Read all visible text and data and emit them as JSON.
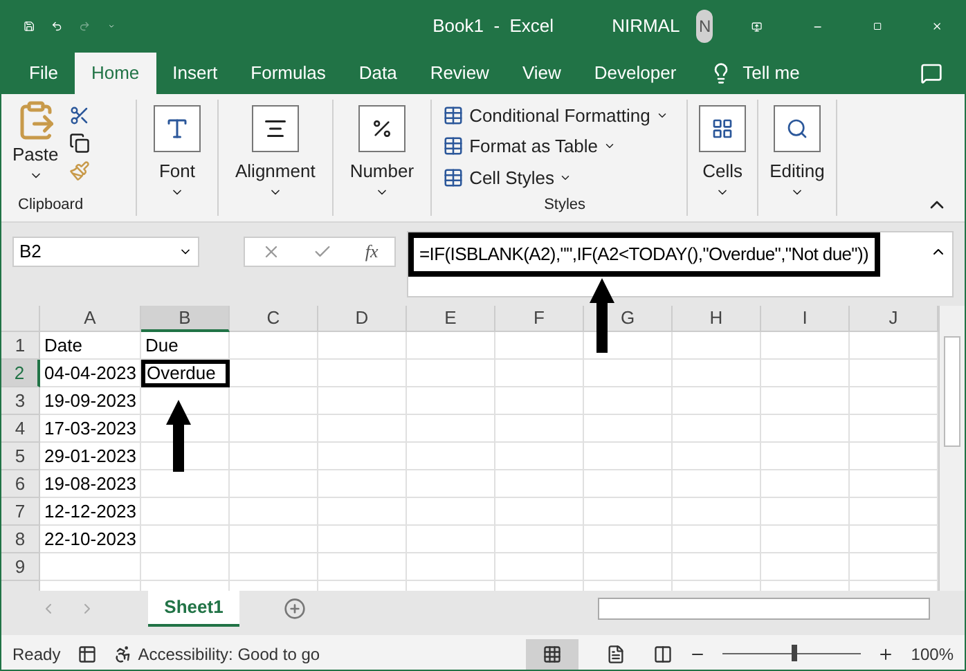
{
  "title_bar": {
    "title": "Book1  -  Excel",
    "user": "NIRMAL",
    "avatar": "N"
  },
  "ribbon_tabs": [
    {
      "label": "File",
      "selected": false
    },
    {
      "label": "Home",
      "selected": true
    },
    {
      "label": "Insert",
      "selected": false
    },
    {
      "label": "Formulas",
      "selected": false
    },
    {
      "label": "Data",
      "selected": false
    },
    {
      "label": "Review",
      "selected": false
    },
    {
      "label": "View",
      "selected": false
    },
    {
      "label": "Developer",
      "selected": false
    }
  ],
  "tell_me": "Tell me",
  "ribbon": {
    "clipboard": {
      "paste": "Paste",
      "group": "Clipboard"
    },
    "font": "Font",
    "alignment": "Alignment",
    "number": "Number",
    "styles": {
      "items": [
        "Conditional Formatting",
        "Format as Table",
        "Cell Styles"
      ],
      "group": "Styles"
    },
    "cells": "Cells",
    "editing": "Editing"
  },
  "name_box": "B2",
  "function_label": "fx",
  "formula": "=IF(ISBLANK(A2),\"\",IF(A2<TODAY(),\"Overdue\",\"Not due\"))",
  "columns": [
    {
      "label": "A",
      "selected": false
    },
    {
      "label": "B",
      "selected": true
    },
    {
      "label": "C",
      "selected": false
    },
    {
      "label": "D",
      "selected": false
    },
    {
      "label": "E",
      "selected": false
    },
    {
      "label": "F",
      "selected": false
    },
    {
      "label": "G",
      "selected": false
    },
    {
      "label": "H",
      "selected": false
    },
    {
      "label": "I",
      "selected": false
    },
    {
      "label": "J",
      "selected": false
    }
  ],
  "rows": [
    {
      "number": "1",
      "selected": false,
      "cells": [
        "Date",
        "Due"
      ]
    },
    {
      "number": "2",
      "selected": true,
      "cells": [
        "04-04-2023",
        "Overdue"
      ]
    },
    {
      "number": "3",
      "selected": false,
      "cells": [
        "19-09-2023",
        ""
      ]
    },
    {
      "number": "4",
      "selected": false,
      "cells": [
        "17-03-2023",
        ""
      ]
    },
    {
      "number": "5",
      "selected": false,
      "cells": [
        "29-01-2023",
        ""
      ]
    },
    {
      "number": "6",
      "selected": false,
      "cells": [
        "19-08-2023",
        ""
      ]
    },
    {
      "number": "7",
      "selected": false,
      "cells": [
        "12-12-2023",
        ""
      ]
    },
    {
      "number": "8",
      "selected": false,
      "cells": [
        "22-10-2023",
        ""
      ]
    },
    {
      "number": "9",
      "selected": false,
      "cells": [
        "",
        ""
      ]
    }
  ],
  "sheet_tabs": [
    {
      "label": "Sheet1",
      "selected": true
    }
  ],
  "status_bar": {
    "status": "Ready",
    "accessibility": "Accessibility: Good to go",
    "zoom": "100%",
    "level": 0.5
  }
}
